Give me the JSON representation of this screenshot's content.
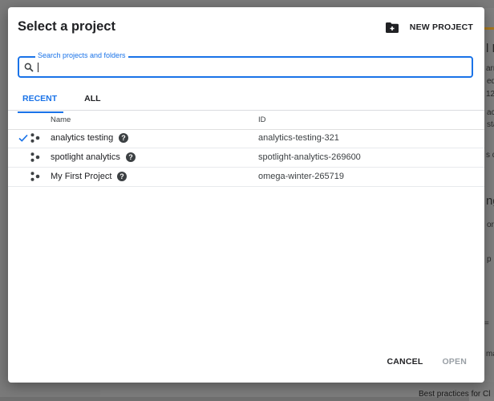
{
  "dialog": {
    "title": "Select a project",
    "new_project_label": "NEW PROJECT",
    "search": {
      "legend": "Search projects and folders",
      "value": "",
      "placeholder": ""
    },
    "tabs": [
      {
        "label": "RECENT",
        "active": true
      },
      {
        "label": "ALL",
        "active": false
      }
    ],
    "table": {
      "columns": [
        "Name",
        "ID"
      ],
      "rows": [
        {
          "name": "analytics testing",
          "id": "analytics-testing-321",
          "selected": true
        },
        {
          "name": "spotlight analytics",
          "id": "spotlight-analytics-269600",
          "selected": false
        },
        {
          "name": "My First Project",
          "id": "omega-winter-265719",
          "selected": false
        }
      ]
    },
    "buttons": {
      "cancel": "CANCEL",
      "open": "OPEN"
    }
  },
  "background": {
    "fragments": [
      "l P",
      "arr",
      "ed",
      "12",
      "ac",
      "sta",
      "s d",
      "ng",
      "ors",
      "p I",
      "= ",
      "ma",
      "Best practices for Cl"
    ]
  },
  "colors": {
    "accent": "#1a73e8",
    "text": "#202124",
    "disabled": "#9aa0a6"
  }
}
